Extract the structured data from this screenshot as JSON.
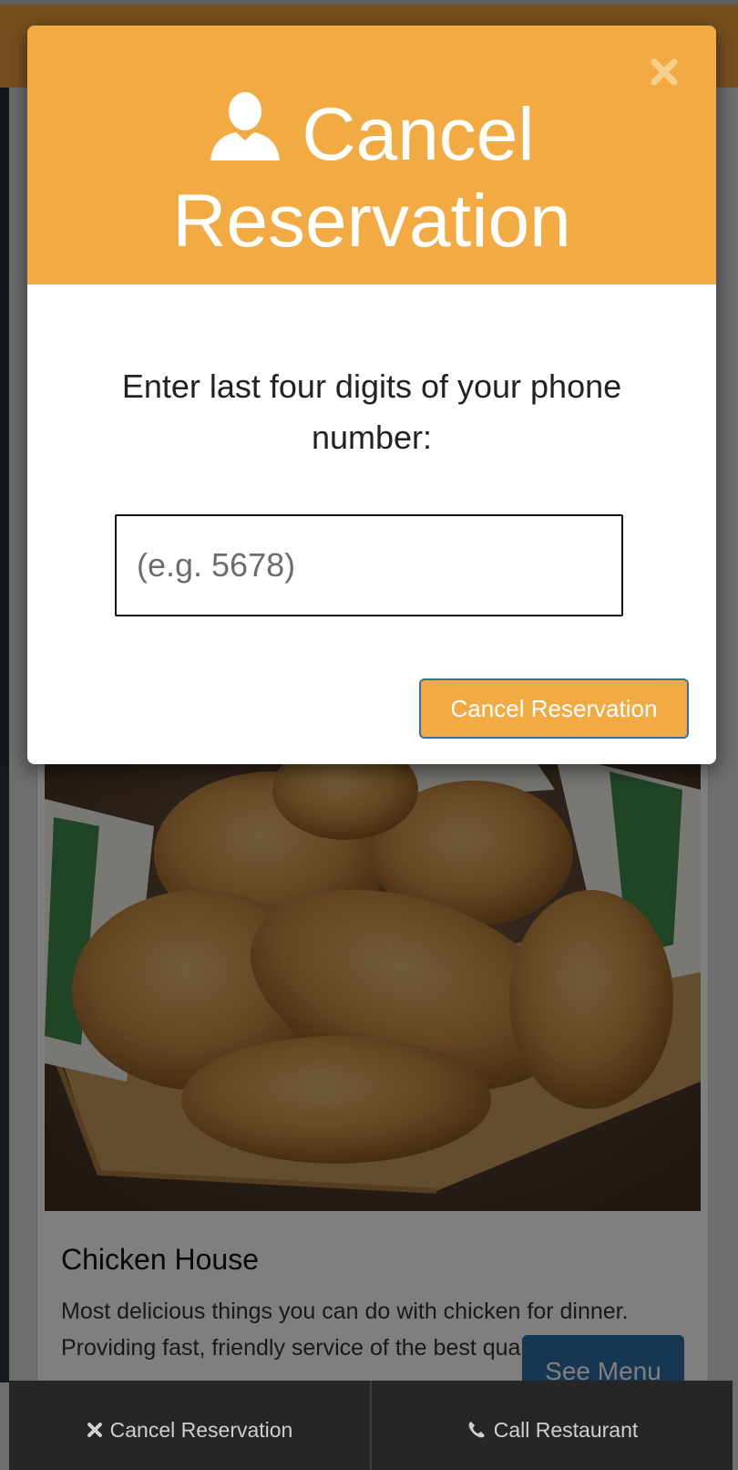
{
  "modal": {
    "title_line1": "Cancel",
    "title_line2": "Reservation",
    "prompt": "Enter last four digits of your phone number:",
    "input_placeholder": "(e.g. 5678)",
    "submit_label": "Cancel Reservation",
    "header_color": "#f2ab43"
  },
  "card": {
    "title": "Chicken House",
    "description": "Most delicious things you can do with chicken for dinner. Providing fast, friendly service of the best quality food!",
    "button_label": "See Menu"
  },
  "bottom_bar": {
    "cancel_label": "Cancel Reservation",
    "call_label": "Call Restaurant"
  },
  "icons": {
    "close": "close-icon",
    "user": "user-icon",
    "cancel": "x-icon",
    "phone": "phone-icon"
  }
}
